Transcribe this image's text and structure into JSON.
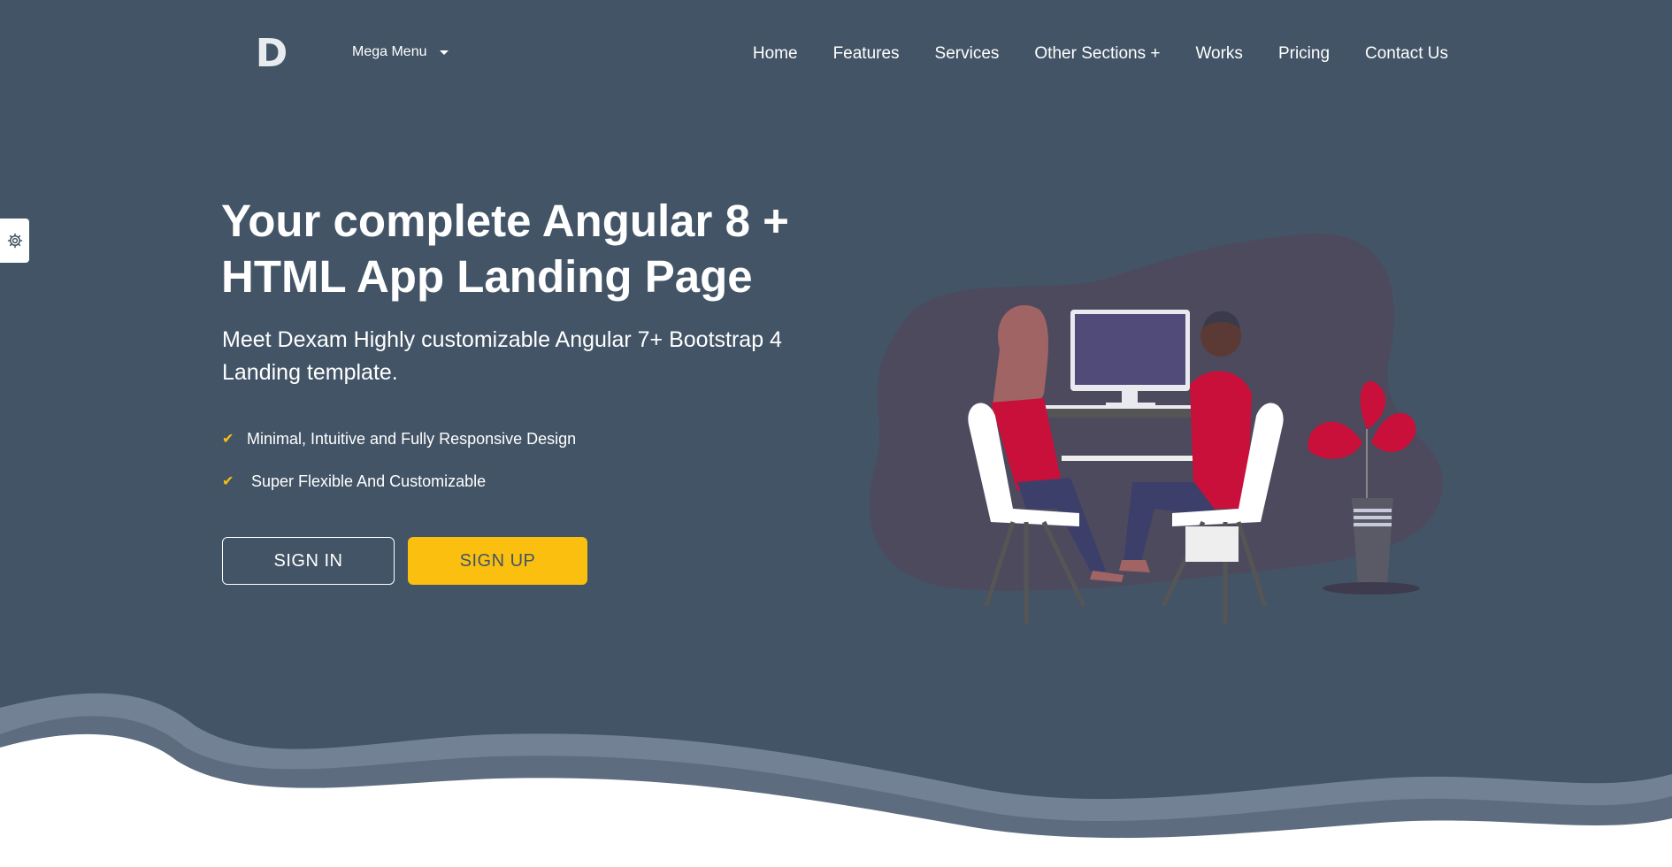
{
  "header": {
    "logo_letter": "D",
    "mega_menu_label": "Mega Menu",
    "nav": [
      "Home",
      "Features",
      "Services",
      "Other Sections +",
      "Works",
      "Pricing",
      "Contact Us"
    ]
  },
  "hero": {
    "title_line1": "Your complete Angular 8 +",
    "title_line2": "HTML App Landing Page",
    "subtitle": "Meet Dexam Highly customizable Angular 7+ Bootstrap 4 Landing template.",
    "features": [
      "Minimal, Intuitive and Fully Responsive Design",
      "Super Flexible And Customizable"
    ],
    "signin_label": "SIGN IN",
    "signup_label": "SIGN UP"
  },
  "icons": {
    "settings": "gear-icon",
    "check": "check-icon",
    "dropdown": "chevron-down-icon"
  },
  "colors": {
    "background": "#425466",
    "accent": "#fbbf0f",
    "illustration_red": "#c8103a",
    "blob": "#4d4a5e"
  }
}
